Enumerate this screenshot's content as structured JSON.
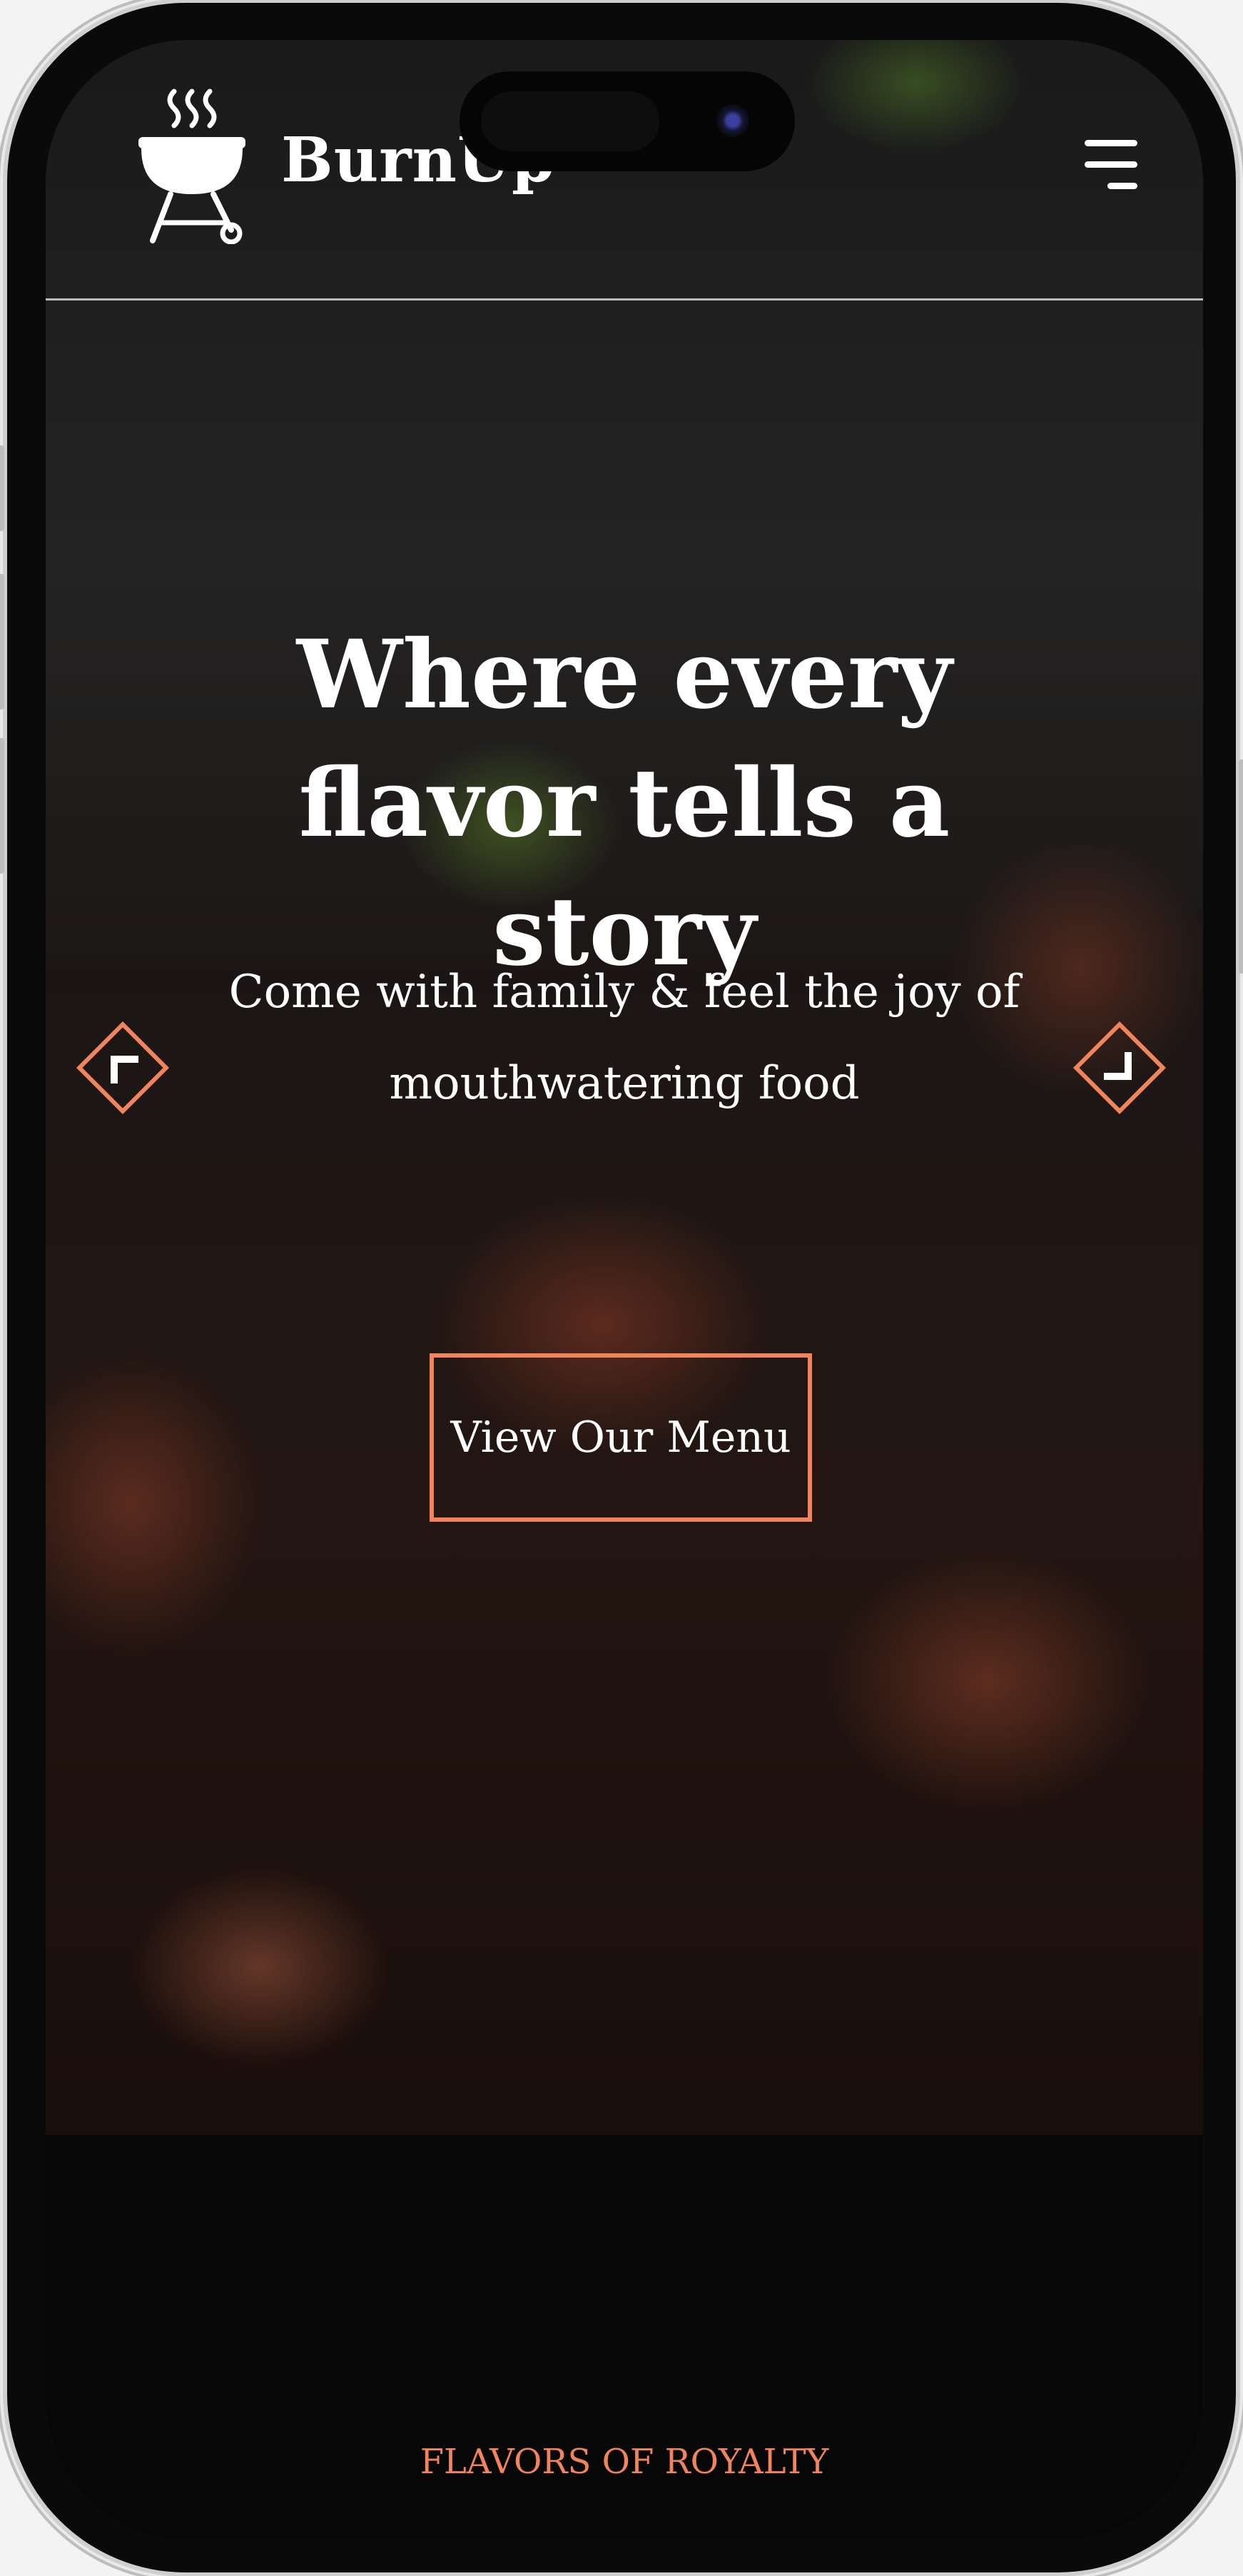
{
  "header": {
    "brand": "BurnUp",
    "logo_icon": "bbq-grill-icon",
    "menu_icon": "hamburger-menu-icon"
  },
  "hero": {
    "headline": "Where every flavor tells a story",
    "subtext": "Come with family & feel the joy of mouthwatering food",
    "cta_label": "View Our Menu",
    "prev_icon": "chevron-left-icon",
    "next_icon": "chevron-right-icon"
  },
  "section": {
    "label": "FLAVORS OF ROYALTY"
  },
  "colors": {
    "accent": "#f0845a",
    "text": "#ffffff",
    "background": "#070707"
  }
}
